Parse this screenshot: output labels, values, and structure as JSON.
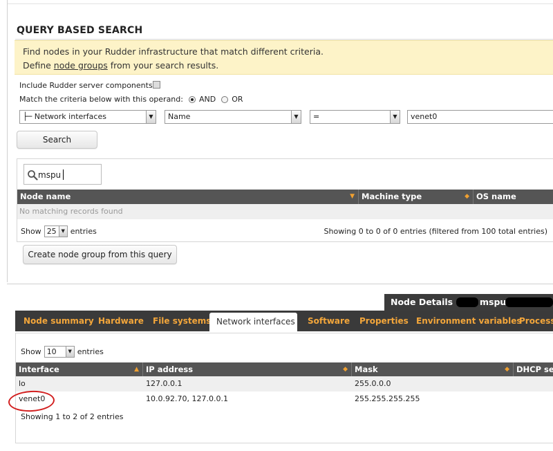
{
  "query": {
    "title": "QUERY BASED SEARCH",
    "info_line1": "Find nodes in your Rudder infrastructure that match different criteria.",
    "info_line2_prefix": "Define ",
    "info_line2_link": "node groups",
    "info_line2_suffix": " from your search results.",
    "include_label": "Include Rudder server components:",
    "operand_label": "Match the criteria below with this operand:",
    "operand_and": "AND",
    "operand_or": "OR",
    "criteria": {
      "object_type": "├─ Network interfaces",
      "attribute": "Name",
      "comparator": "=",
      "value": "venet0"
    },
    "search_button": "Search",
    "results": {
      "filter_value": "mspu",
      "columns": [
        "Node name",
        "Machine type",
        "OS name"
      ],
      "empty_message": "No matching records found",
      "show_label": "Show",
      "show_value": "25",
      "entries_label": "entries",
      "info": "Showing 0 to 0 of 0 entries (filtered from 100 total entries)"
    },
    "create_group_button": "Create node group from this query"
  },
  "node_details": {
    "title": "Node Details -",
    "node_name": "mspu",
    "tabs": [
      "Node summary",
      "Hardware",
      "File systems",
      "Network interfaces",
      "Software",
      "Properties",
      "Environment variables",
      "Processes"
    ],
    "active_tab": "Network interfaces",
    "show_label": "Show",
    "show_value": "10",
    "entries_label": "entries",
    "columns": [
      "Interface",
      "IP address",
      "Mask",
      "DHCP serv"
    ],
    "rows": [
      {
        "interface": "lo",
        "ip": "127.0.0.1",
        "mask": "255.0.0.0"
      },
      {
        "interface": "venet0",
        "ip": "10.0.92.70, 127.0.0.1",
        "mask": "255.255.255.255"
      }
    ],
    "footer": "Showing 1 to 2 of 2 entries"
  },
  "colors": {
    "info_bg": "#fdf3c8",
    "table_header": "#555555",
    "tab_text": "#f3a63a",
    "highlight": "#d21f1f"
  }
}
